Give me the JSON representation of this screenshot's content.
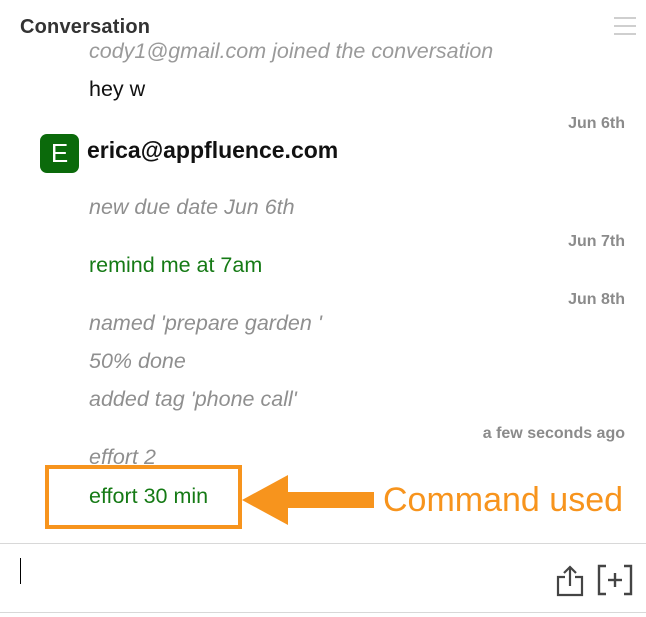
{
  "header": {
    "title": "Conversation",
    "menu_icon": "hamburger-menu-icon"
  },
  "messages": {
    "joined_clipped": "cody1@gmail.com joined the conversation",
    "hey": "hey w",
    "author_initial": "E",
    "author_name": "erica@appfluence.com",
    "due_date": "new due date Jun 6th",
    "remind": "remind me at 7am",
    "named": "named 'prepare garden '",
    "done": "50% done",
    "tag": "added tag 'phone call'",
    "effort2": "effort 2",
    "effort30": "effort 30 min"
  },
  "timestamps": {
    "jun6": "Jun 6th",
    "jun7": "Jun 7th",
    "jun8": "Jun 8th",
    "recent": "a few seconds ago"
  },
  "annotation": {
    "label": "Command used",
    "color": "#f7941d"
  },
  "composer": {
    "value": "",
    "share_icon": "share-icon",
    "expand_icon": "expand-icon"
  },
  "colors": {
    "command_green": "#157a15",
    "avatar_green": "#0b6a0b",
    "system_gray": "#8f8f8f"
  }
}
